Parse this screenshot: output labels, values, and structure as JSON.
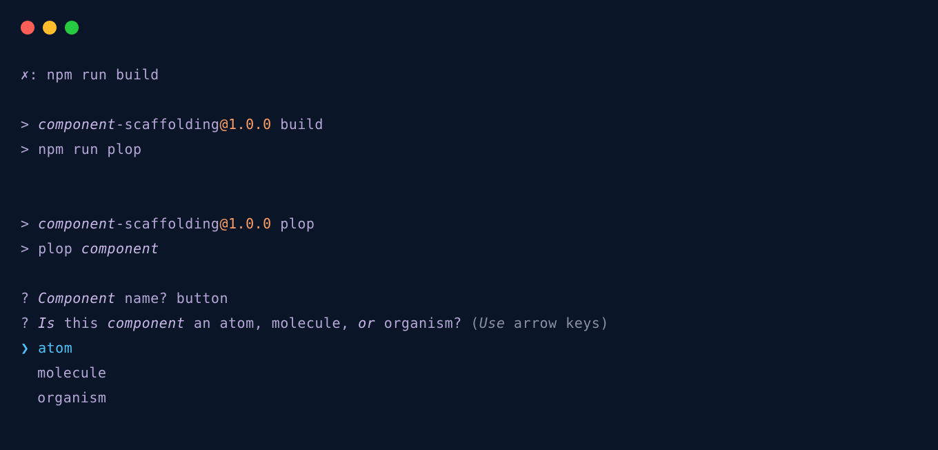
{
  "window": {
    "traffic_lights": [
      "close",
      "minimize",
      "zoom"
    ]
  },
  "terminal": {
    "prompt": {
      "symbol": "✗:",
      "command": "npm run build"
    },
    "script1": {
      "gt": ">",
      "pkg_prefix": "component",
      "pkg_suffix": "-scaffolding",
      "at_version": "@1.0.0",
      "task": " build"
    },
    "script1_cmd": {
      "gt": ">",
      "cmd": " npm run plop"
    },
    "script2": {
      "gt": ">",
      "pkg_prefix": "component",
      "pkg_suffix": "-scaffolding",
      "at_version": "@1.0.0",
      "task": " plop"
    },
    "script2_cmd": {
      "gt": ">",
      "cmd1": " plop ",
      "cmd2": "component"
    },
    "q1": {
      "mark": "?",
      "word1": "Component",
      "rest": " name? button"
    },
    "q2": {
      "mark": "?",
      "w_is": "Is",
      "sp1": " this ",
      "w_component": "component",
      "sp2": " an atom, molecule, ",
      "w_or": "or",
      "sp3": " organism? ",
      "paren_open": "(",
      "w_use": "Use",
      "hint_rest": " arrow keys",
      "paren_close": ")"
    },
    "options": {
      "selector": "❯",
      "opt0": " atom",
      "opt1": "molecule",
      "opt2": "organism"
    }
  }
}
